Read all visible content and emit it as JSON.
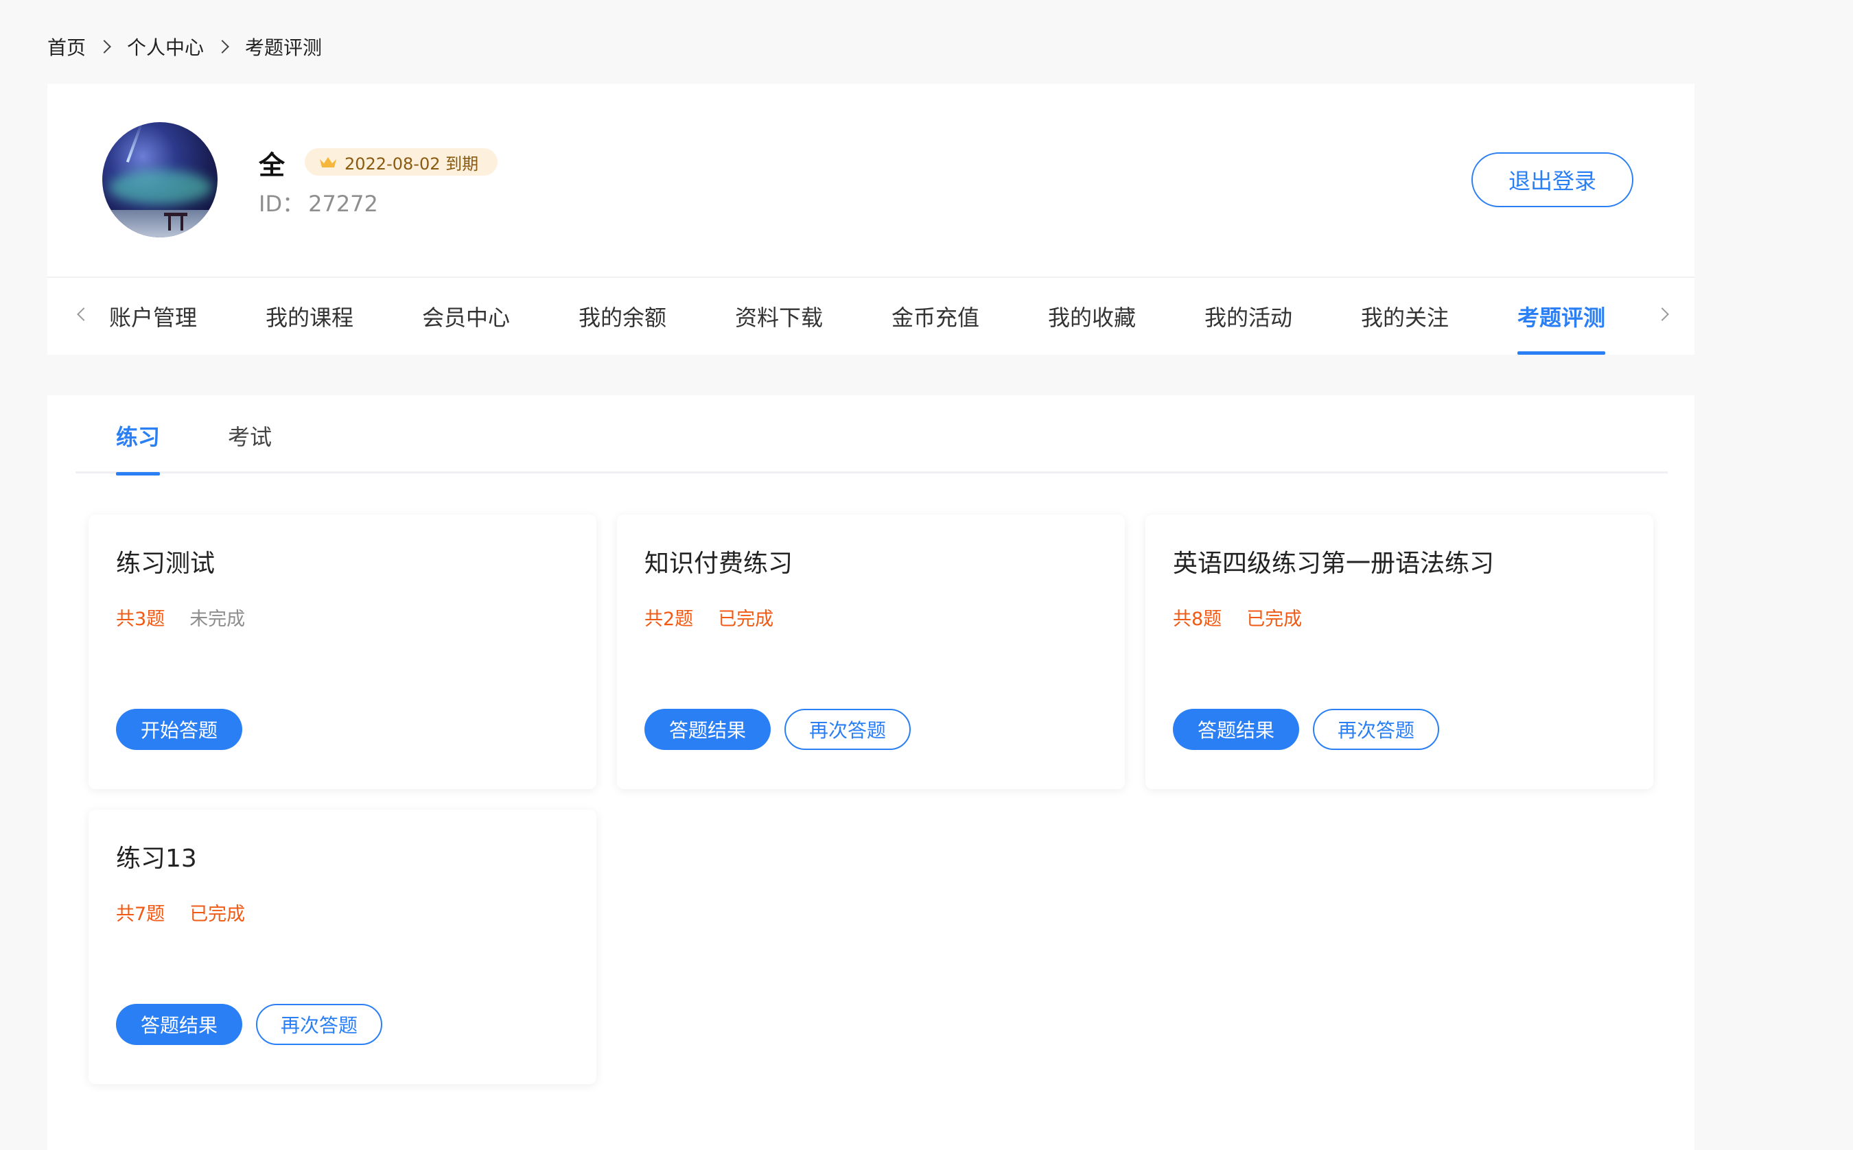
{
  "breadcrumb": {
    "items": [
      "首页",
      "个人中心",
      "考题评测"
    ]
  },
  "profile": {
    "name": "全",
    "vip_expiry": "2022-08-02 到期",
    "id_label": "ID：",
    "id_value": "27272",
    "logout_label": "退出登录"
  },
  "nav": {
    "tabs": [
      "账户管理",
      "我的课程",
      "会员中心",
      "我的余额",
      "资料下载",
      "金币充值",
      "我的收藏",
      "我的活动",
      "我的关注",
      "考题评测"
    ],
    "active": "考题评测"
  },
  "sub_tabs": {
    "items": [
      "练习",
      "考试"
    ],
    "active": "练习"
  },
  "exams": [
    {
      "title": "练习测试",
      "count": "共3题",
      "status": "未完成",
      "primary_action": "开始答题",
      "secondary_action": ""
    },
    {
      "title": "知识付费练习",
      "count": "共2题",
      "status": "已完成",
      "primary_action": "答题结果",
      "secondary_action": "再次答题"
    },
    {
      "title": "英语四级练习第一册语法练习",
      "count": "共8题",
      "status": "已完成",
      "primary_action": "答题结果",
      "secondary_action": "再次答题"
    },
    {
      "title": "练习13",
      "count": "共7题",
      "status": "已完成",
      "primary_action": "答题结果",
      "secondary_action": "再次答题"
    }
  ],
  "colors": {
    "accent": "#2b7ff5",
    "highlight": "#f05a14",
    "muted": "#8e8e8e",
    "badge_bg": "#fdf1dd"
  }
}
